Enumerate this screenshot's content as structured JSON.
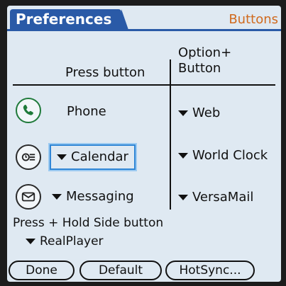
{
  "header": {
    "title": "Preferences",
    "category": "Buttons"
  },
  "columns": {
    "press": "Press button",
    "option_line1": "Option+",
    "option_line2": "Button"
  },
  "rows": [
    {
      "icon": "phone-icon",
      "press_value": "Phone",
      "option_value": "Web"
    },
    {
      "icon": "calendar-icon",
      "press_value": "Calendar",
      "option_value": "World Clock"
    },
    {
      "icon": "messaging-icon",
      "press_value": "Messaging",
      "option_value": "VersaMail"
    }
  ],
  "hold": {
    "label": "Press + Hold Side button",
    "value": "RealPlayer"
  },
  "buttons": {
    "done": "Done",
    "default": "Default",
    "hotsync": "HotSync..."
  },
  "colors": {
    "title_bar": "#2a5aa7",
    "category_text": "#d06a1e",
    "background": "#dfe9f2",
    "focus_ring": "#2f86d6"
  }
}
